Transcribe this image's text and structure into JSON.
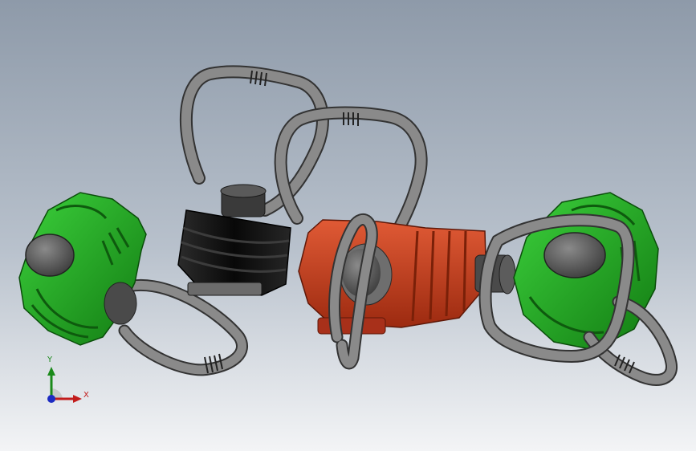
{
  "triad": {
    "x_label": "X",
    "y_label": "Y"
  },
  "colors": {
    "loop": "#858585",
    "loop_edge": "#333333",
    "green": "#1fa81f",
    "red": "#c23a1c",
    "black": "#141414"
  }
}
